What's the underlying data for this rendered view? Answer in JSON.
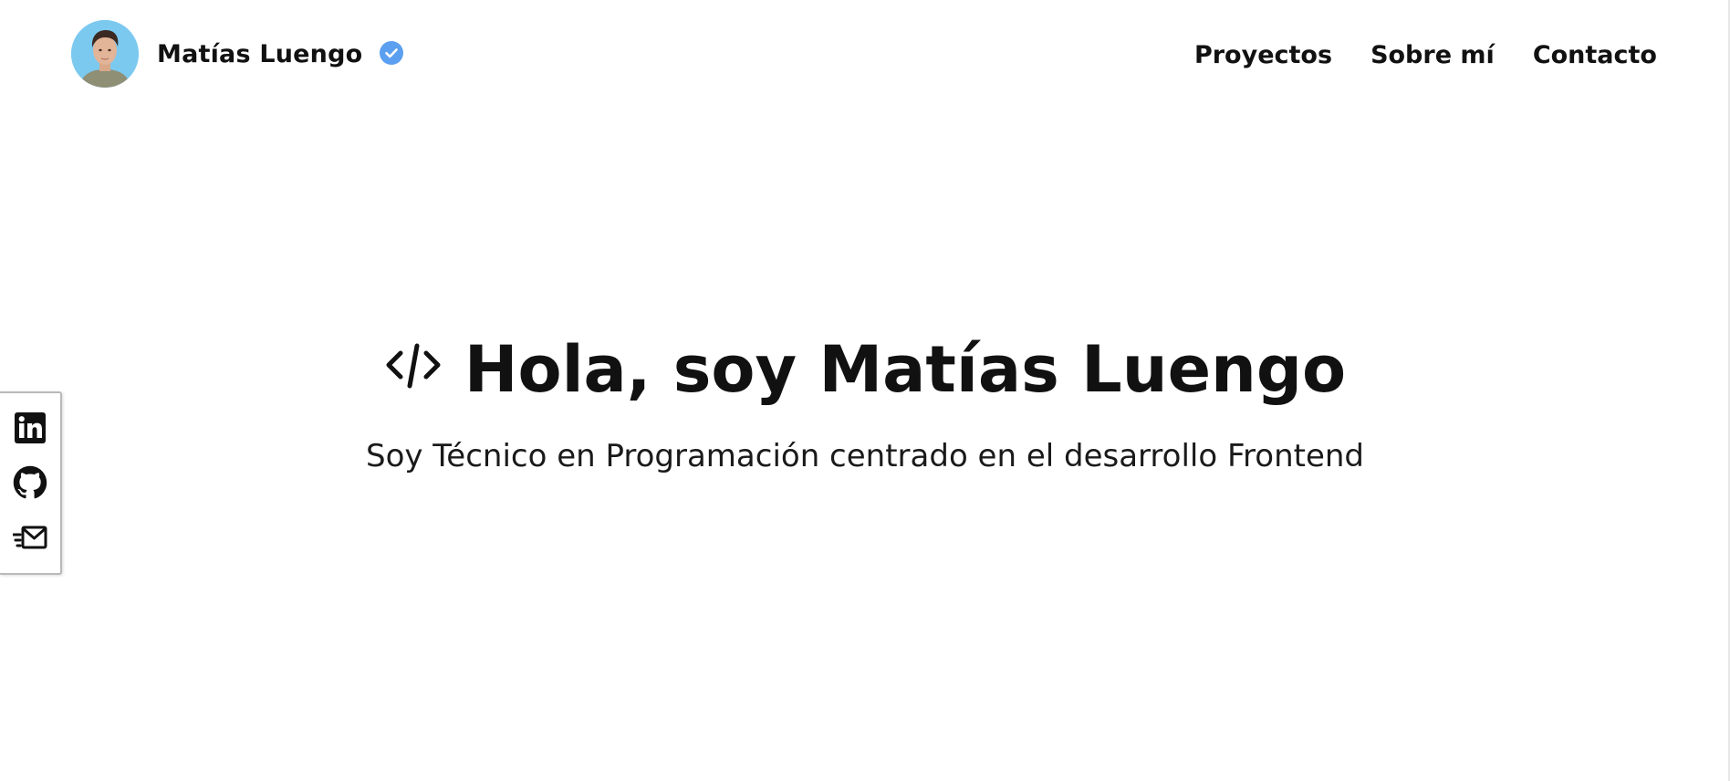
{
  "header": {
    "name": "Matías Luengo",
    "avatar_icon": "profile-photo",
    "verified_icon": "verified-badge-icon",
    "verified_color": "#5b9ff0",
    "nav": [
      {
        "label": "Proyectos"
      },
      {
        "label": "Sobre mí"
      },
      {
        "label": "Contacto"
      }
    ]
  },
  "hero": {
    "icon": "code-icon",
    "title": "Hola, soy Matías Luengo",
    "subtitle": "Soy Técnico en Programación centrado en el desarrollo Frontend"
  },
  "social": {
    "items": [
      {
        "icon": "linkedin-icon"
      },
      {
        "icon": "github-icon"
      },
      {
        "icon": "mail-send-icon"
      }
    ]
  },
  "colors": {
    "text": "#111111",
    "background": "#ffffff",
    "avatar_bg": "#7cc9f0"
  }
}
